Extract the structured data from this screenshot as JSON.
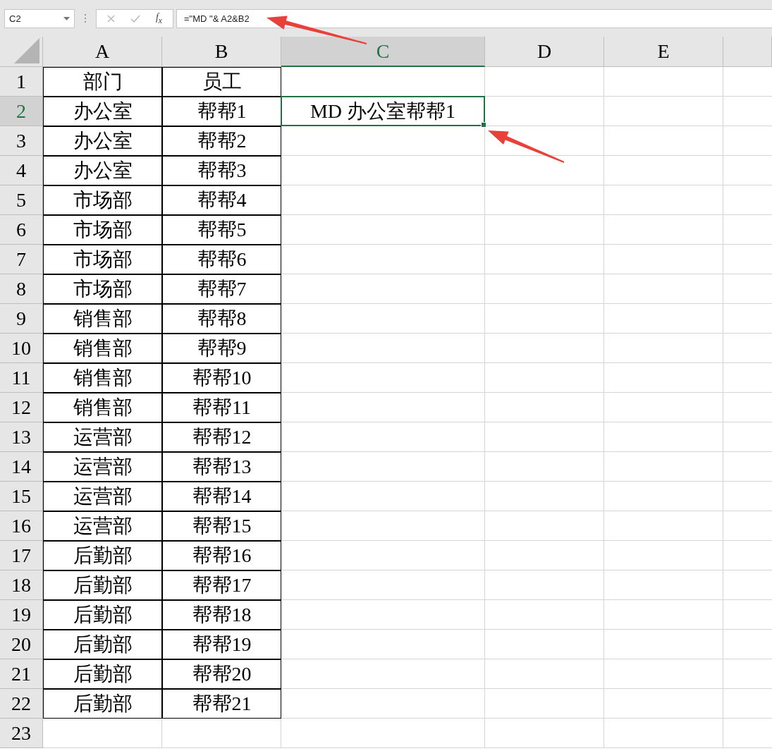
{
  "formula_bar": {
    "name_box": "C2",
    "function_label": "f$_{x}$",
    "formula": "=\"MD \"& A2&B2"
  },
  "columns": [
    {
      "label": "A",
      "selected": false
    },
    {
      "label": "B",
      "selected": false
    },
    {
      "label": "C",
      "selected": true
    },
    {
      "label": "D",
      "selected": false
    },
    {
      "label": "E",
      "selected": false
    }
  ],
  "rows": [
    {
      "label": "1",
      "selected": false,
      "cells": [
        "部门",
        "员工"
      ]
    },
    {
      "label": "2",
      "selected": true,
      "cells": [
        "办公室",
        "帮帮1",
        "MD 办公室帮帮1"
      ]
    },
    {
      "label": "3",
      "selected": false,
      "cells": [
        "办公室",
        "帮帮2"
      ]
    },
    {
      "label": "4",
      "selected": false,
      "cells": [
        "办公室",
        "帮帮3"
      ]
    },
    {
      "label": "5",
      "selected": false,
      "cells": [
        "市场部",
        "帮帮4"
      ]
    },
    {
      "label": "6",
      "selected": false,
      "cells": [
        "市场部",
        "帮帮5"
      ]
    },
    {
      "label": "7",
      "selected": false,
      "cells": [
        "市场部",
        "帮帮6"
      ]
    },
    {
      "label": "8",
      "selected": false,
      "cells": [
        "市场部",
        "帮帮7"
      ]
    },
    {
      "label": "9",
      "selected": false,
      "cells": [
        "销售部",
        "帮帮8"
      ]
    },
    {
      "label": "10",
      "selected": false,
      "cells": [
        "销售部",
        "帮帮9"
      ]
    },
    {
      "label": "11",
      "selected": false,
      "cells": [
        "销售部",
        "帮帮10"
      ]
    },
    {
      "label": "12",
      "selected": false,
      "cells": [
        "销售部",
        "帮帮11"
      ]
    },
    {
      "label": "13",
      "selected": false,
      "cells": [
        "运营部",
        "帮帮12"
      ]
    },
    {
      "label": "14",
      "selected": false,
      "cells": [
        "运营部",
        "帮帮13"
      ]
    },
    {
      "label": "15",
      "selected": false,
      "cells": [
        "运营部",
        "帮帮14"
      ]
    },
    {
      "label": "16",
      "selected": false,
      "cells": [
        "运营部",
        "帮帮15"
      ]
    },
    {
      "label": "17",
      "selected": false,
      "cells": [
        "后勤部",
        "帮帮16"
      ]
    },
    {
      "label": "18",
      "selected": false,
      "cells": [
        "后勤部",
        "帮帮17"
      ]
    },
    {
      "label": "19",
      "selected": false,
      "cells": [
        "后勤部",
        "帮帮18"
      ]
    },
    {
      "label": "20",
      "selected": false,
      "cells": [
        "后勤部",
        "帮帮19"
      ]
    },
    {
      "label": "21",
      "selected": false,
      "cells": [
        "后勤部",
        "帮帮20"
      ]
    },
    {
      "label": "22",
      "selected": false,
      "cells": [
        "后勤部",
        "帮帮21"
      ]
    },
    {
      "label": "23",
      "selected": false
    }
  ]
}
